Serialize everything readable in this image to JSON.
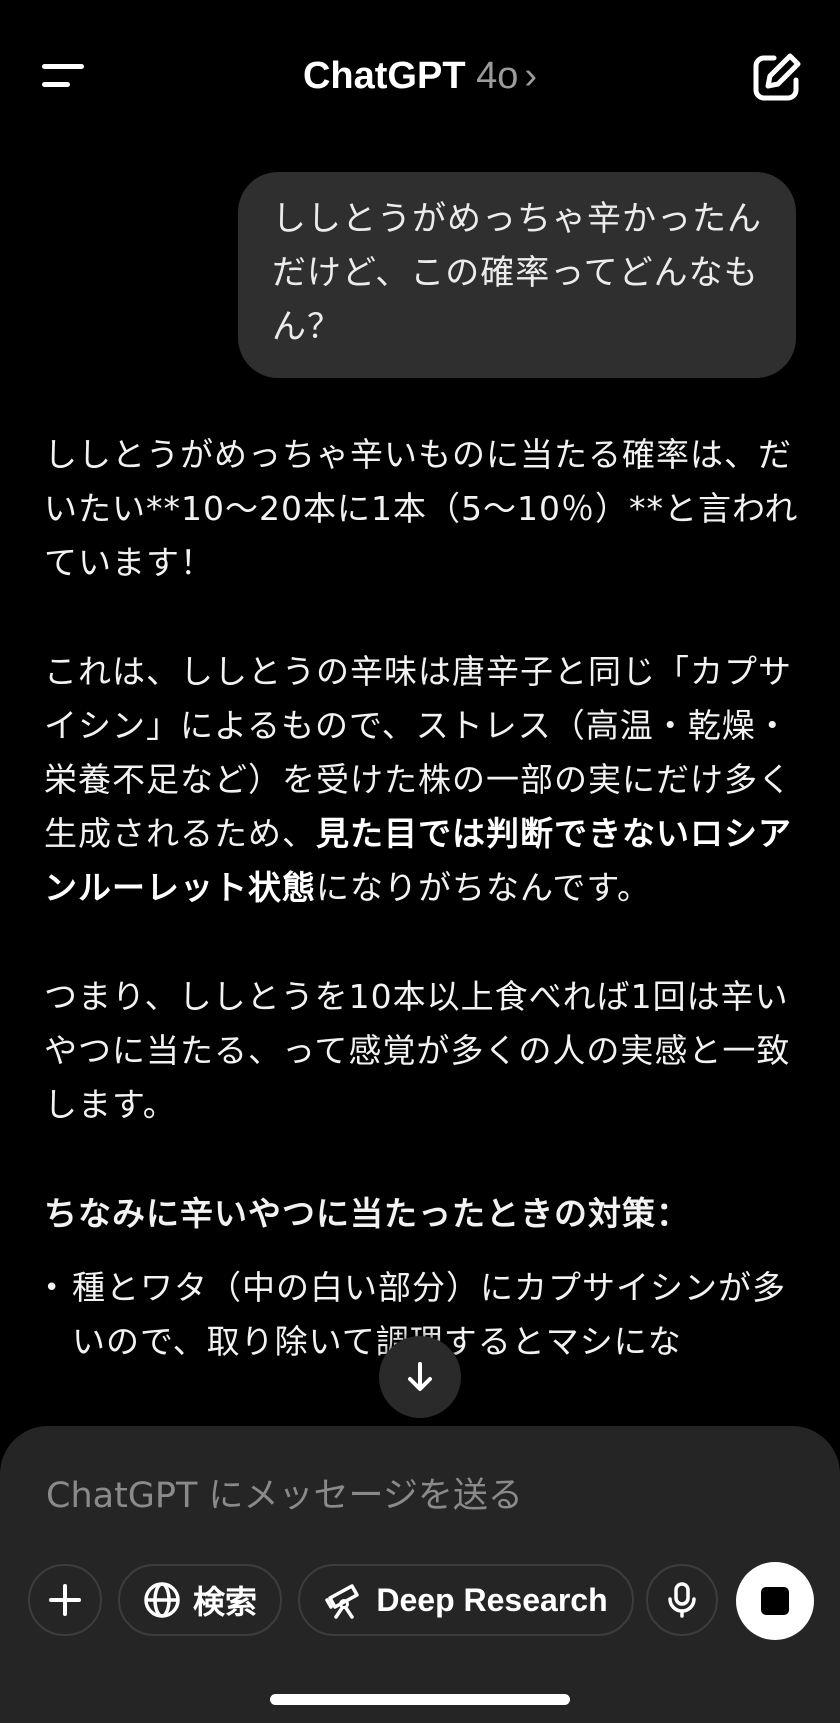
{
  "header": {
    "title": "ChatGPT",
    "model": "4o",
    "chevron": "›",
    "menu_icon": "hamburger-icon",
    "compose_icon": "new-chat-icon"
  },
  "messages": {
    "user": {
      "text": "ししとうがめっちゃ辛かったんだけど、この確率ってどんなもん？"
    },
    "assistant": {
      "p1": "ししとうがめっちゃ辛いものに当たる確率は、だいたい**10〜20本に1本（5〜10％）**と言われています！",
      "p2_a": "これは、ししとうの辛味は唐辛子と同じ「カプサイシン」によるもので、ストレス（高温・乾燥・栄養不足など）を受けた株の一部の実にだけ多く生成されるため、",
      "p2_bold": "見た目では判断できないロシアンルーレット状態",
      "p2_b": "になりがちなんです。",
      "p3": "つまり、ししとうを10本以上食べれば1回は辛いやつに当たる、って感覚が多くの人の実感と一致します。",
      "heading": "ちなみに辛いやつに当たったときの対策：",
      "bullet1": "種とワタ（中の白い部分）にカプサイシンが多いので、取り除いて調理するとマシにな"
    }
  },
  "scroll_button": {
    "icon": "arrow-down-icon"
  },
  "composer": {
    "placeholder": "ChatGPT にメッセージを送る",
    "plus_icon": "plus-icon",
    "search_label": "検索",
    "search_icon": "globe-icon",
    "deep_research_label": "Deep Research",
    "deep_research_icon": "telescope-icon",
    "mic_icon": "microphone-icon",
    "stop_icon": "stop-icon"
  },
  "colors": {
    "background": "#000000",
    "bubble": "#2f2f2f",
    "composer": "#252525",
    "muted_text": "#9b9b9b"
  }
}
